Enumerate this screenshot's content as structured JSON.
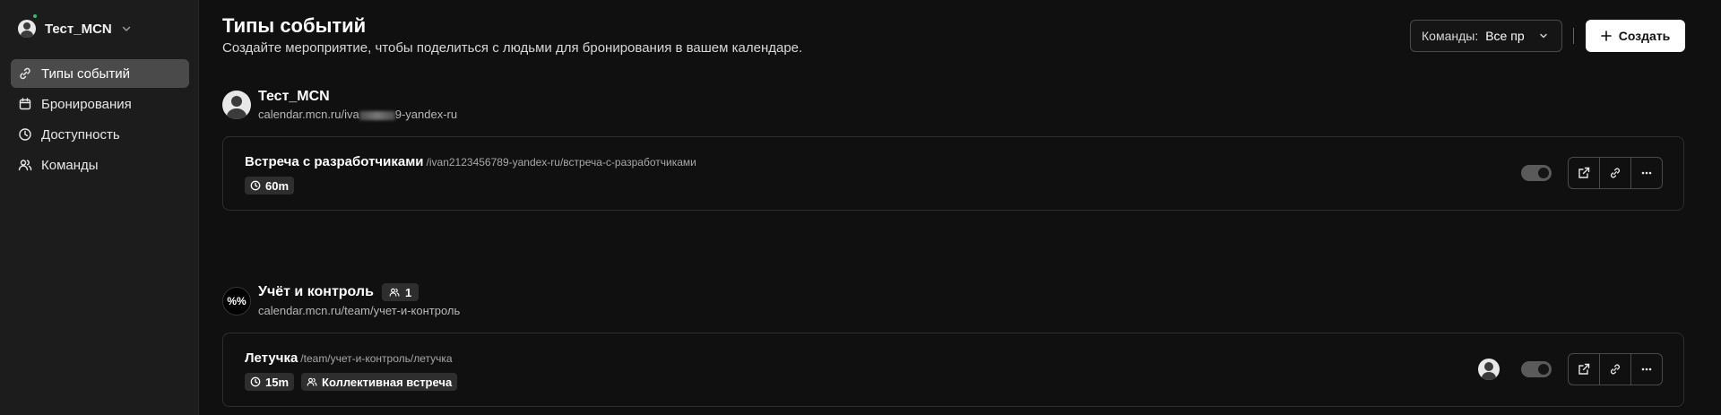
{
  "sidebar": {
    "user_name": "Тест_MCN",
    "items": [
      {
        "label": "Типы событий",
        "icon": "link-icon",
        "active": true
      },
      {
        "label": "Бронирования",
        "icon": "calendar-icon",
        "active": false
      },
      {
        "label": "Доступность",
        "icon": "clock-icon",
        "active": false
      },
      {
        "label": "Команды",
        "icon": "users-icon",
        "active": false
      }
    ]
  },
  "header": {
    "title": "Типы событий",
    "subtitle": "Создайте мероприятие, чтобы поделиться с людьми для бронирования в вашем календаре.",
    "team_filter_label": "Команды:",
    "team_filter_value": "Все пр",
    "create_label": "Создать"
  },
  "groups": [
    {
      "name": "Тест_MCN",
      "link_prefix": "calendar.mcn.ru/iva",
      "link_suffix": "9-yandex-ru",
      "events": [
        {
          "title": "Встреча с разработчиками",
          "slug": "/ivan2123456789-yandex-ru/встреча-с-разработчиками",
          "duration": "60m",
          "enabled": true
        }
      ]
    },
    {
      "name": "Учёт и контроль",
      "avatar_text": "%%",
      "members_count": "1",
      "link": "calendar.mcn.ru/team/учет-и-контроль",
      "events": [
        {
          "title": "Летучка",
          "slug": "/team/учет-и-контроль/летучка",
          "duration": "15m",
          "type_label": "Коллективная встреча",
          "enabled": true
        }
      ]
    }
  ],
  "colors": {
    "background": "#101010",
    "sidebar": "#1c1c1c",
    "active_nav": "#4a4a4a",
    "online": "#2fbf71",
    "primary_button": "#ffffff"
  }
}
